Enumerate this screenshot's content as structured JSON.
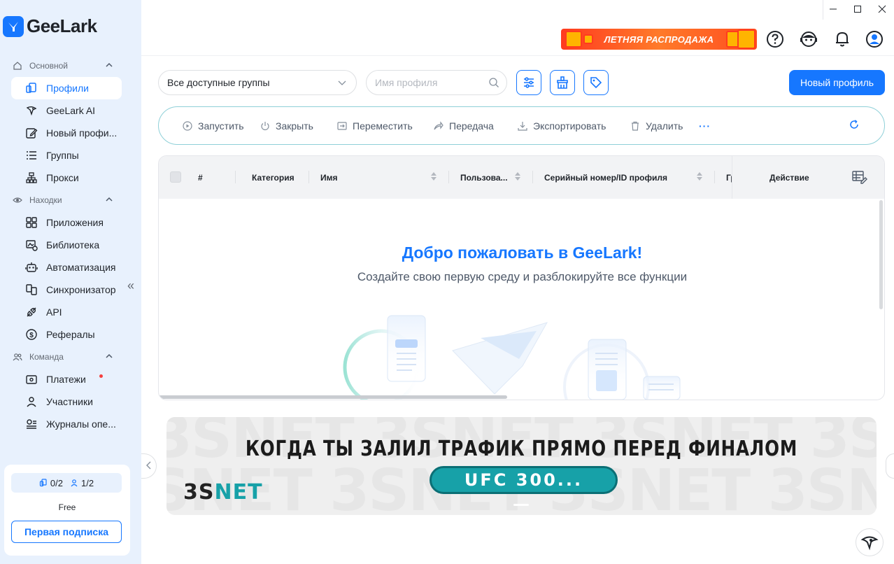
{
  "app": {
    "name": "GeeLark"
  },
  "window": {
    "minimize": "—",
    "maximize": "☐",
    "close": "✕"
  },
  "sidebar": {
    "sections": [
      {
        "title": "Основной",
        "items": [
          "Профили",
          "GeeLark AI",
          "Новый профи...",
          "Группы",
          "Прокси"
        ]
      },
      {
        "title": "Находки",
        "items": [
          "Приложения",
          "Библиотека",
          "Автоматизация",
          "Синхронизатор",
          "API",
          "Рефералы"
        ]
      },
      {
        "title": "Команда",
        "items": [
          "Платежи",
          "Участники",
          "Журналы опе..."
        ]
      }
    ],
    "plan": {
      "profiles": "0/2",
      "members": "1/2",
      "name": "Free",
      "button": "Первая подписка"
    }
  },
  "header": {
    "promo": "ЛЕТНЯЯ РАСПРОДАЖА"
  },
  "toolbar": {
    "group_select": "Все доступные группы",
    "search_placeholder": "Имя профиля",
    "new_profile": "Новый профиль"
  },
  "actions": [
    "Запустить",
    "Закрыть",
    "Переместить",
    "Передача",
    "Экспортировать",
    "Удалить",
    "···"
  ],
  "table": {
    "columns": [
      "#",
      "Категория",
      "Имя",
      "Пользова...",
      "Серийный номер/ID профиля",
      "Гр",
      "Действие"
    ],
    "empty_title": "Добро пожаловать в GeeLark!",
    "empty_subtitle": "Создайте свою первую среду и разблокируйте все функции"
  },
  "banner": {
    "watermark": "3SNET 3SNET 3SNET 3SNET 3SNET 3SNET",
    "title": "КОГДА ТЫ ЗАЛИЛ ТРАФИК ПРЯМО ПЕРЕД ФИНАЛОМ",
    "pill": "UFC 300...",
    "brand_main": "3S",
    "brand_accent": "NET"
  },
  "colors": {
    "accent": "#1677ff",
    "sidebar_bg": "#e8f1fd",
    "teal": "#17a1a8"
  }
}
